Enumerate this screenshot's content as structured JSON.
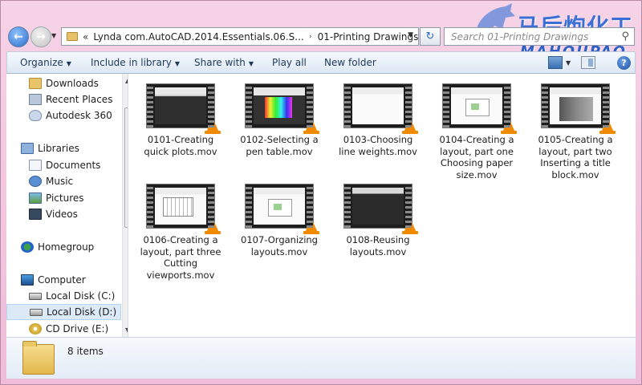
{
  "address": {
    "overflow": "«",
    "crumbs": [
      "Lynda com.AutoCAD.2014.Essentials.06.S...",
      "01-Printing Drawings"
    ],
    "separator": "›"
  },
  "search": {
    "placeholder": "Search 01-Printing Drawings"
  },
  "watermark": {
    "cn": "马后炮化工",
    "en": "MAHOUPAO"
  },
  "toolbar": {
    "organize": "Organize",
    "include": "Include in library",
    "share": "Share with",
    "play": "Play all",
    "new_folder": "New folder",
    "help": "?"
  },
  "nav": {
    "favorites": [
      "Downloads",
      "Recent Places",
      "Autodesk 360"
    ],
    "libraries": "Libraries",
    "library_items": [
      "Documents",
      "Music",
      "Pictures",
      "Videos"
    ],
    "homegroup": "Homegroup",
    "computer": "Computer",
    "drives": [
      "Local Disk (C:)",
      "Local Disk (D:)",
      "CD Drive (E:)"
    ],
    "selected": "Local Disk (D:)"
  },
  "files": [
    {
      "name": "0101-Creating quick plots.mov",
      "thumb": "gray"
    },
    {
      "name": "0102-Selecting a pen table.mov",
      "thumb": "color"
    },
    {
      "name": "0103-Choosing line weights.mov",
      "thumb": "white"
    },
    {
      "name": "0104-Creating a layout, part one Choosing paper size.mov",
      "thumb": "layout"
    },
    {
      "name": "0105-Creating a layout, part two Inserting a title block.mov",
      "thumb": "title"
    },
    {
      "name": "0106-Creating a layout, part three Cutting viewports.mov",
      "thumb": "plan"
    },
    {
      "name": "0107-Organizing layouts.mov",
      "thumb": "layout"
    },
    {
      "name": "0108-Reusing layouts.mov",
      "thumb": "dark"
    }
  ],
  "details": {
    "count": "8 items"
  },
  "colors": {
    "frame": "#f2c6e0",
    "accent": "#2d6bc9",
    "vlc": "#f08a00"
  }
}
